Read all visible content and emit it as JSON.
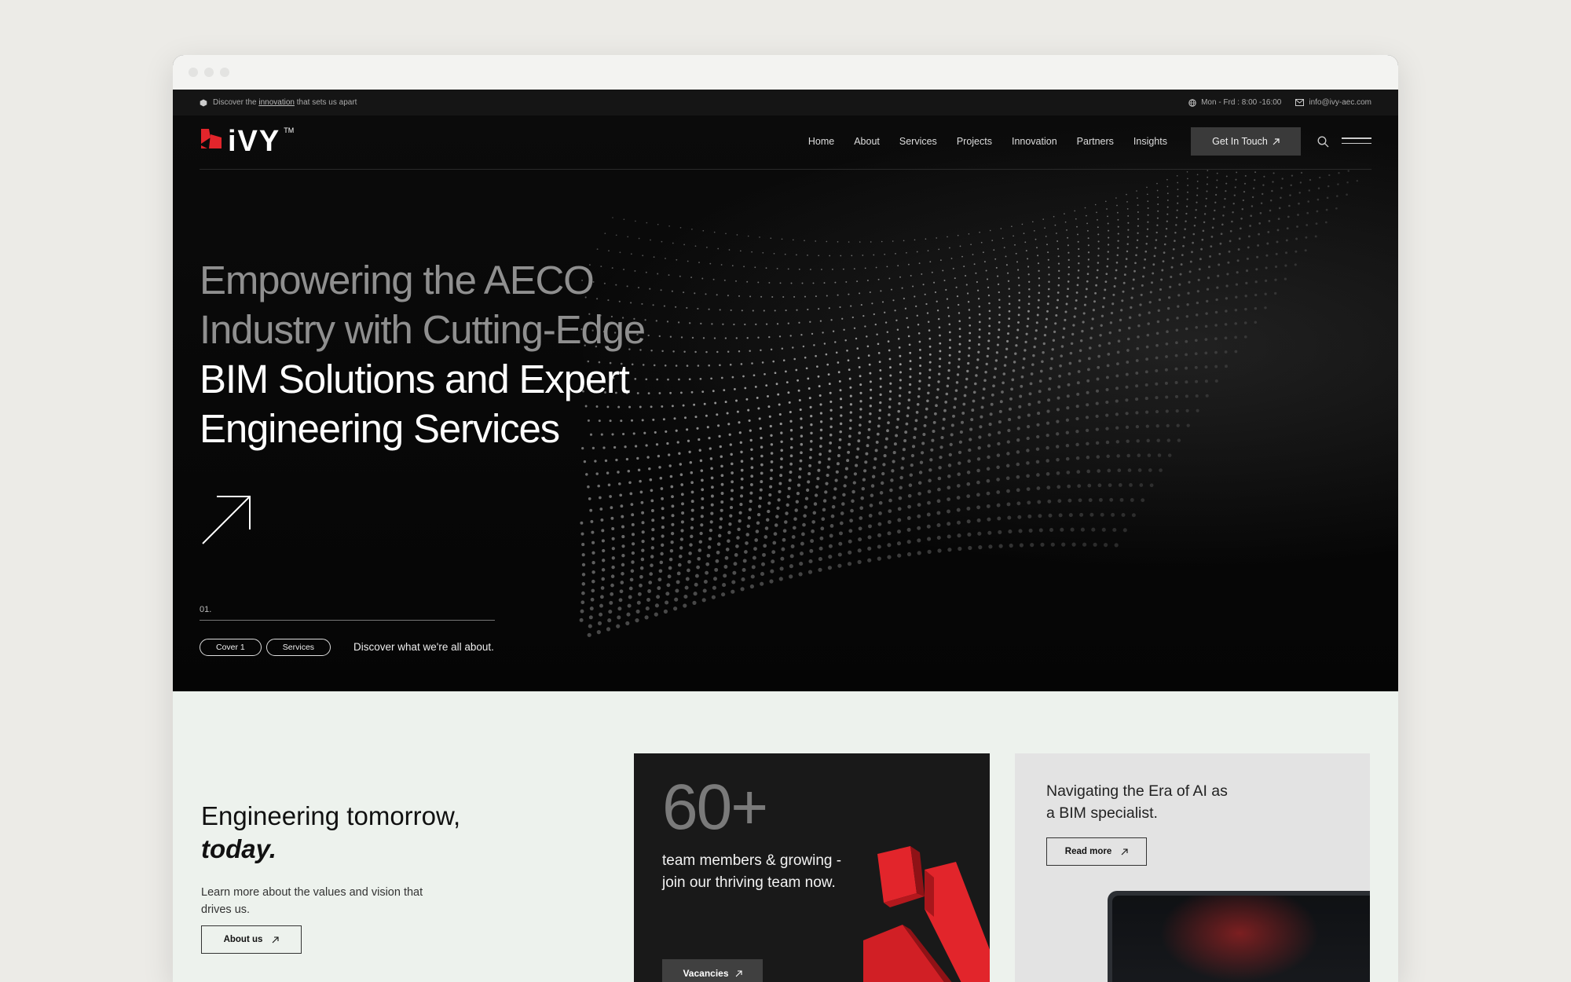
{
  "topbar": {
    "announcement_prefix": "Discover the",
    "announcement_link": "innovation",
    "announcement_suffix": "that sets us apart",
    "hours": "Mon - Frd : 8:00 -16:00",
    "email": "info@ivy-aec.com"
  },
  "brand": {
    "logo_text": "iVY",
    "trademark": "TM",
    "accent_color": "#e2252b"
  },
  "nav": {
    "items": [
      "Home",
      "About",
      "Services",
      "Projects",
      "Innovation",
      "Partners",
      "Insights"
    ],
    "cta_label": "Get In Touch"
  },
  "hero": {
    "headline_dim_1": "Empowering the AECO",
    "headline_dim_2": "Industry with Cutting-Edge",
    "headline_bright_1": "BIM Solutions and Expert",
    "headline_bright_2": "Engineering Services",
    "slide_number": "01.",
    "chips": [
      "Cover 1",
      "Services"
    ],
    "discover_text": "Discover what we're all about."
  },
  "intro": {
    "title_line": "Engineering tomorrow,",
    "title_emphasis": "today.",
    "description": "Learn more about the values and vision that drives us.",
    "button_label": "About us"
  },
  "team_card": {
    "stat": "60+",
    "text": "team members & growing - join our thriving team now.",
    "button_label": "Vacancies"
  },
  "ai_card": {
    "title": "Navigating the Era of AI as a BIM specialist.",
    "button_label": "Read more"
  }
}
